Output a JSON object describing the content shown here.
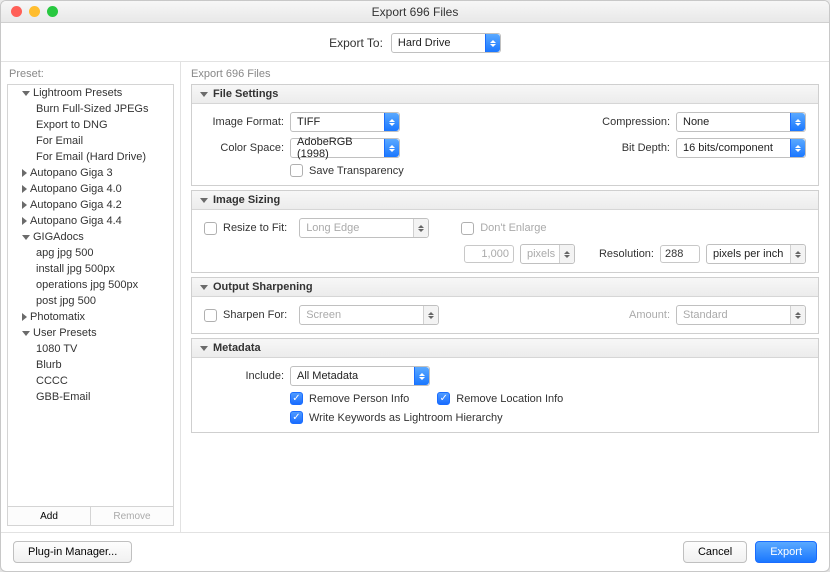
{
  "title": "Export 696 Files",
  "exportTo": {
    "label": "Export To:",
    "value": "Hard Drive"
  },
  "presetLabel": "Preset:",
  "mainLabel": "Export 696 Files",
  "presetTree": [
    {
      "label": "Lightroom Presets",
      "expanded": true,
      "children": [
        {
          "label": "Burn Full-Sized JPEGs"
        },
        {
          "label": "Export to DNG"
        },
        {
          "label": "For Email"
        },
        {
          "label": "For Email (Hard Drive)"
        }
      ]
    },
    {
      "label": "Autopano Giga 3",
      "expanded": false
    },
    {
      "label": "Autopano Giga 4.0",
      "expanded": false
    },
    {
      "label": "Autopano Giga 4.2",
      "expanded": false
    },
    {
      "label": "Autopano Giga 4.4",
      "expanded": false
    },
    {
      "label": "GIGAdocs",
      "expanded": true,
      "children": [
        {
          "label": "apg jpg 500"
        },
        {
          "label": "install jpg 500px"
        },
        {
          "label": "operations jpg 500px"
        },
        {
          "label": "post jpg 500"
        }
      ]
    },
    {
      "label": "Photomatix",
      "expanded": false
    },
    {
      "label": "User Presets",
      "expanded": true,
      "children": [
        {
          "label": "1080 TV"
        },
        {
          "label": "Blurb"
        },
        {
          "label": "CCCC"
        },
        {
          "label": "GBB-Email"
        }
      ]
    }
  ],
  "sidebarButtons": {
    "add": "Add",
    "remove": "Remove"
  },
  "sections": {
    "fileSettings": {
      "title": "File Settings",
      "imageFormatLabel": "Image Format:",
      "imageFormat": "TIFF",
      "compressionLabel": "Compression:",
      "compression": "None",
      "colorSpaceLabel": "Color Space:",
      "colorSpace": "AdobeRGB (1998)",
      "bitDepthLabel": "Bit Depth:",
      "bitDepth": "16 bits/component",
      "saveTransparency": "Save Transparency"
    },
    "imageSizing": {
      "title": "Image Sizing",
      "resizeToFit": "Resize to Fit:",
      "resizeMode": "Long Edge",
      "dontEnlarge": "Don't Enlarge",
      "sizeValue": "1,000",
      "sizeUnit": "pixels",
      "resolutionLabel": "Resolution:",
      "resolution": "288",
      "resolutionUnit": "pixels per inch"
    },
    "outputSharpening": {
      "title": "Output Sharpening",
      "sharpenFor": "Sharpen For:",
      "sharpenTarget": "Screen",
      "amountLabel": "Amount:",
      "amount": "Standard"
    },
    "metadata": {
      "title": "Metadata",
      "includeLabel": "Include:",
      "include": "All Metadata",
      "removePerson": "Remove Person Info",
      "removeLocation": "Remove Location Info",
      "writeKeywords": "Write Keywords as Lightroom Hierarchy"
    }
  },
  "footer": {
    "pluginManager": "Plug-in Manager...",
    "cancel": "Cancel",
    "export": "Export"
  }
}
